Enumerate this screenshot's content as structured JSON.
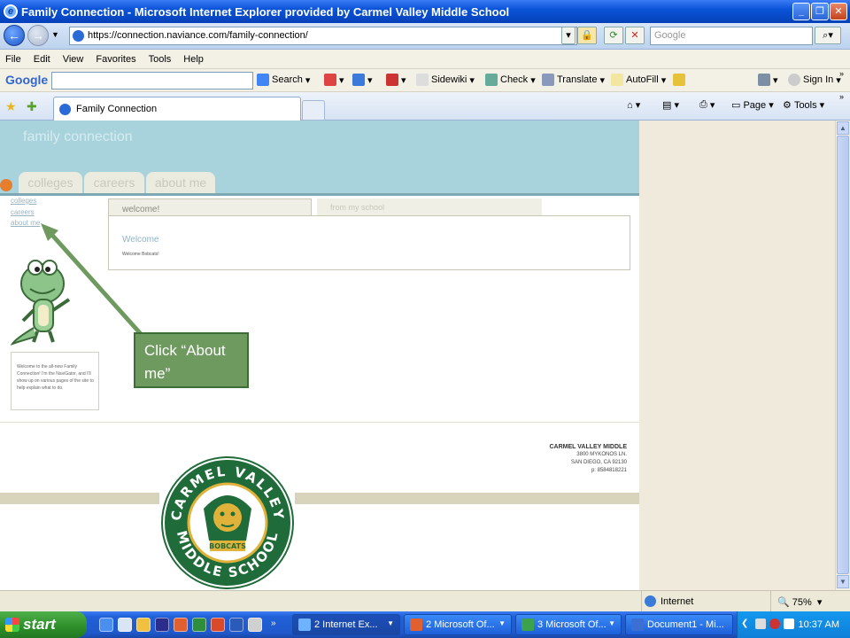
{
  "window": {
    "title": "Family Connection - Microsoft Internet Explorer provided by Carmel Valley Middle School",
    "url": "https://connection.naviance.com/family-connection/",
    "search_placeholder": "Google"
  },
  "menubar": [
    "File",
    "Edit",
    "View",
    "Favorites",
    "Tools",
    "Help"
  ],
  "googlebar": {
    "logo": "Google",
    "tools": [
      "Search",
      "Sidewiki",
      "Check",
      "Translate",
      "AutoFill",
      "Sign In"
    ]
  },
  "tabs": {
    "active": "Family Connection"
  },
  "command_bar": {
    "page": "Page",
    "tools": "Tools"
  },
  "page": {
    "site_title": "family connection",
    "nav_tabs": [
      "colleges",
      "careers",
      "about me"
    ],
    "side_links": [
      "colleges",
      "careers",
      "about me"
    ],
    "content_tabs": [
      "welcome!",
      "from my school"
    ],
    "welcome_heading": "Welcome",
    "welcome_text": "Welcome Bobcats!",
    "gator_text": "Welcome to the all-new Family Connection! I'm the NaviGator, and I'll show up on various pages of the site to help explain what to do.",
    "callout": "Click “About me”",
    "school": {
      "name": "CARMEL VALLEY MIDDLE",
      "street": "3800 MYKONOS LN.",
      "city": "SAN DIEGO, CA 92130",
      "phone": "p: 8584818221"
    },
    "logo": {
      "top_text": "CARMEL VALLEY",
      "bottom_text": "MIDDLE SCHOOL",
      "mascot": "BOBCATS"
    }
  },
  "status": {
    "zone": "Internet",
    "zoom": "75%"
  },
  "taskbar": {
    "start": "start",
    "tasks": [
      "2 Internet Ex...",
      "2 Microsoft Of...",
      "3 Microsoft Of...",
      "Document1 - Mi..."
    ],
    "clock": "10:37 AM"
  },
  "colors": {
    "header": "#a9d3dc",
    "callout": "#6f9a5f",
    "logo_green": "#1f6b3a",
    "logo_gold": "#e0b23a"
  }
}
